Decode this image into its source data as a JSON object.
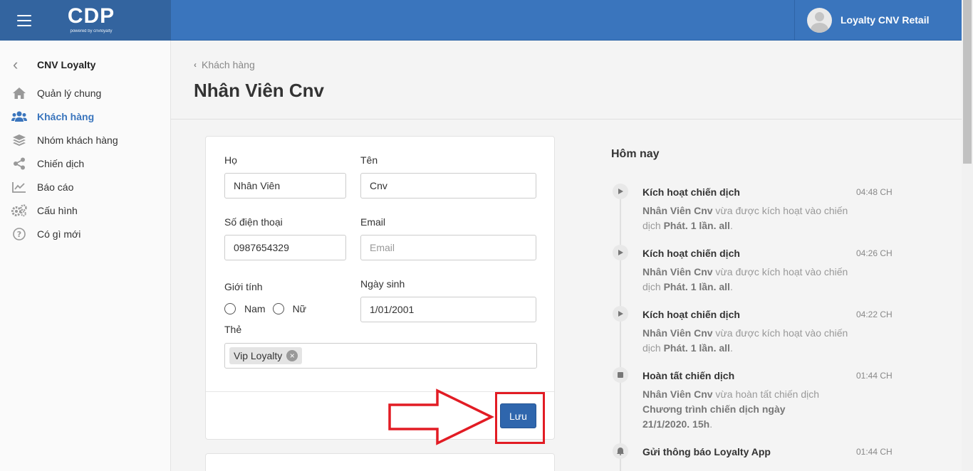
{
  "topbar": {
    "logo": "CDP",
    "logo_sub": "powered by cnvloyalty",
    "user_name": "Loyalty CNV Retail"
  },
  "sidebar": {
    "back_label": "CNV Loyalty",
    "items": [
      {
        "label": "Quản lý chung",
        "icon": "home-icon"
      },
      {
        "label": "Khách hàng",
        "icon": "users-icon",
        "active": true
      },
      {
        "label": "Nhóm khách hàng",
        "icon": "layers-icon"
      },
      {
        "label": "Chiến dịch",
        "icon": "share-icon"
      },
      {
        "label": "Báo cáo",
        "icon": "line-chart-icon"
      },
      {
        "label": "Cấu hình",
        "icon": "cogs-icon"
      },
      {
        "label": "Có gì mới",
        "icon": "question-icon"
      }
    ]
  },
  "header": {
    "breadcrumb": "Khách hàng",
    "title": "Nhân Viên Cnv"
  },
  "form": {
    "last_name": {
      "label": "Họ",
      "value": "Nhân Viên"
    },
    "first_name": {
      "label": "Tên",
      "value": "Cnv"
    },
    "phone": {
      "label": "Số điện thoại",
      "value": "0987654329"
    },
    "email": {
      "label": "Email",
      "value": "",
      "placeholder": "Email"
    },
    "gender": {
      "label": "Giới tính",
      "options": [
        "Nam",
        "Nữ"
      ]
    },
    "birthday": {
      "label": "Ngày sinh",
      "value": "1/01/2001"
    },
    "tags": {
      "label": "Thẻ",
      "items": [
        "Vip Loyalty"
      ]
    },
    "save_label": "Lưu"
  },
  "timeline": {
    "title": "Hôm nay",
    "events": [
      {
        "title": "Kích hoạt chiến dịch",
        "time": "04:48 CH",
        "icon": "play-icon",
        "who": "Nhân Viên Cnv",
        "text": " vừa được kích hoạt vào chiến dịch ",
        "target": "Phát. 1 lần. all",
        "end": "."
      },
      {
        "title": "Kích hoạt chiến dịch",
        "time": "04:26 CH",
        "icon": "play-icon",
        "who": "Nhân Viên Cnv",
        "text": " vừa được kích hoạt vào chiến dịch ",
        "target": "Phát. 1 lần. all",
        "end": "."
      },
      {
        "title": "Kích hoạt chiến dịch",
        "time": "04:22 CH",
        "icon": "play-icon",
        "who": "Nhân Viên Cnv",
        "text": " vừa được kích hoạt vào chiến dịch ",
        "target": "Phát. 1 lần. all",
        "end": "."
      },
      {
        "title": "Hoàn tất chiến dịch",
        "time": "01:44 CH",
        "icon": "stop-icon",
        "who": "Nhân Viên Cnv",
        "text": " vừa hoàn tất chiến dịch ",
        "target": "Chương trình chiến dịch ngày 21/1/2020. 15h",
        "end": "."
      },
      {
        "title": "Gửi thông báo Loyalty App",
        "time": "01:44 CH",
        "icon": "bell-icon"
      }
    ]
  },
  "colors": {
    "primary": "#3a75bd",
    "button": "#2f66ad",
    "annotation": "#e21c24"
  }
}
